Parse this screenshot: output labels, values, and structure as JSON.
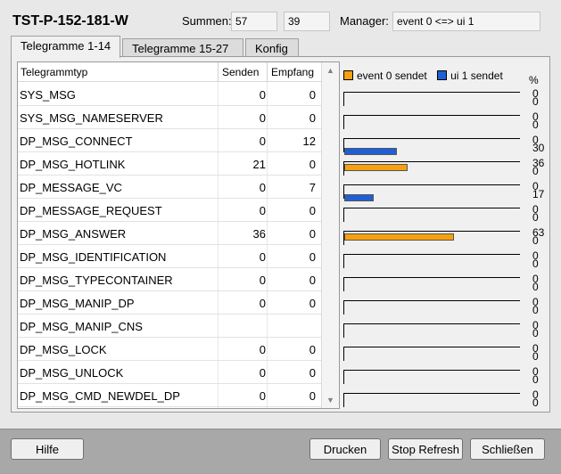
{
  "header": {
    "title": "TST-P-152-181-W",
    "summen_label": "Summen:",
    "sum_send": "57",
    "sum_recv": "39",
    "manager_label": "Manager:",
    "manager_value": "event  0 <=> ui  1"
  },
  "tabs": [
    {
      "label": "Telegramme 1-14",
      "active": true
    },
    {
      "label": "Telegramme 15-27",
      "active": false
    },
    {
      "label": "Konfig",
      "active": false
    }
  ],
  "table": {
    "columns": [
      "Telegrammtyp",
      "Senden",
      "Empfang"
    ],
    "rows": [
      {
        "name": "SYS_MSG",
        "send": "0",
        "recv": "0"
      },
      {
        "name": "SYS_MSG_NAMESERVER",
        "send": "0",
        "recv": "0"
      },
      {
        "name": "DP_MSG_CONNECT",
        "send": "0",
        "recv": "12"
      },
      {
        "name": "DP_MSG_HOTLINK",
        "send": "21",
        "recv": "0"
      },
      {
        "name": "DP_MESSAGE_VC",
        "send": "0",
        "recv": "7"
      },
      {
        "name": "DP_MESSAGE_REQUEST",
        "send": "0",
        "recv": "0"
      },
      {
        "name": "DP_MSG_ANSWER",
        "send": "36",
        "recv": "0"
      },
      {
        "name": "DP_MSG_IDENTIFICATION",
        "send": "0",
        "recv": "0"
      },
      {
        "name": "DP_MSG_TYPECONTAINER",
        "send": "0",
        "recv": "0"
      },
      {
        "name": "DP_MSG_MANIP_DP",
        "send": "0",
        "recv": "0"
      },
      {
        "name": "DP_MSG_MANIP_CNS",
        "send": "",
        "recv": ""
      },
      {
        "name": "DP_MSG_LOCK",
        "send": "0",
        "recv": "0"
      },
      {
        "name": "DP_MSG_UNLOCK",
        "send": "0",
        "recv": "0"
      },
      {
        "name": "DP_MSG_CMD_NEWDEL_DP",
        "send": "0",
        "recv": "0"
      }
    ]
  },
  "chart_data": {
    "type": "bar",
    "legend": [
      "event 0 sendet",
      "ui 1 sendet"
    ],
    "unit_label": "%",
    "colors": {
      "send": "#f5a10f",
      "recv": "#1f5fd6"
    },
    "max": 100,
    "categories": [
      "SYS_MSG",
      "SYS_MSG_NAMESERVER",
      "DP_MSG_CONNECT",
      "DP_MSG_HOTLINK",
      "DP_MESSAGE_VC",
      "DP_MESSAGE_REQUEST",
      "DP_MSG_ANSWER",
      "DP_MSG_IDENTIFICATION",
      "DP_MSG_TYPECONTAINER",
      "DP_MSG_MANIP_DP",
      "DP_MSG_MANIP_CNS",
      "DP_MSG_LOCK",
      "DP_MSG_UNLOCK",
      "DP_MSG_CMD_NEWDEL_DP"
    ],
    "series": [
      {
        "name": "event 0 sendet",
        "values": [
          0,
          0,
          0,
          36,
          0,
          0,
          63,
          0,
          0,
          0,
          0,
          0,
          0,
          0
        ]
      },
      {
        "name": "ui 1 sendet",
        "values": [
          0,
          0,
          30,
          0,
          17,
          0,
          0,
          0,
          0,
          0,
          0,
          0,
          0,
          0
        ]
      }
    ]
  },
  "buttons": {
    "help": "Hilfe",
    "print": "Drucken",
    "stop_refresh": "Stop Refresh",
    "close": "Schließen"
  }
}
